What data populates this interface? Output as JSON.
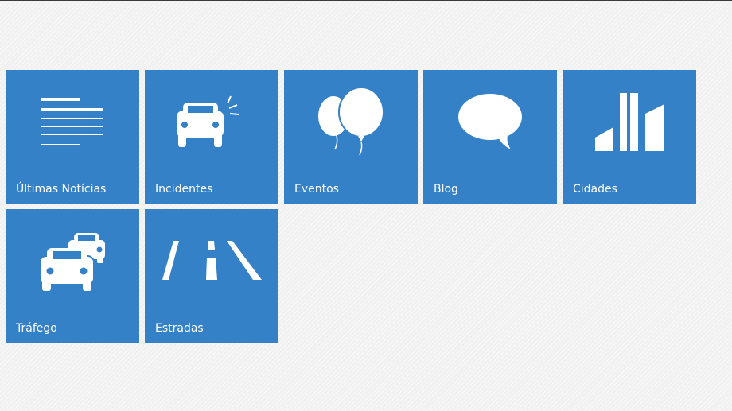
{
  "accent_color": "#3481c8",
  "background_color": "#f1f1f1",
  "tiles": [
    {
      "label": "Últimas Notícias",
      "icon": "news-icon"
    },
    {
      "label": "Incidentes",
      "icon": "car-crash-icon"
    },
    {
      "label": "Eventos",
      "icon": "balloons-icon"
    },
    {
      "label": "Blog",
      "icon": "speech-bubble-icon"
    },
    {
      "label": "Cidades",
      "icon": "city-buildings-icon"
    },
    {
      "label": "Tráfego",
      "icon": "traffic-cars-icon"
    },
    {
      "label": "Estradas",
      "icon": "road-icon"
    }
  ]
}
